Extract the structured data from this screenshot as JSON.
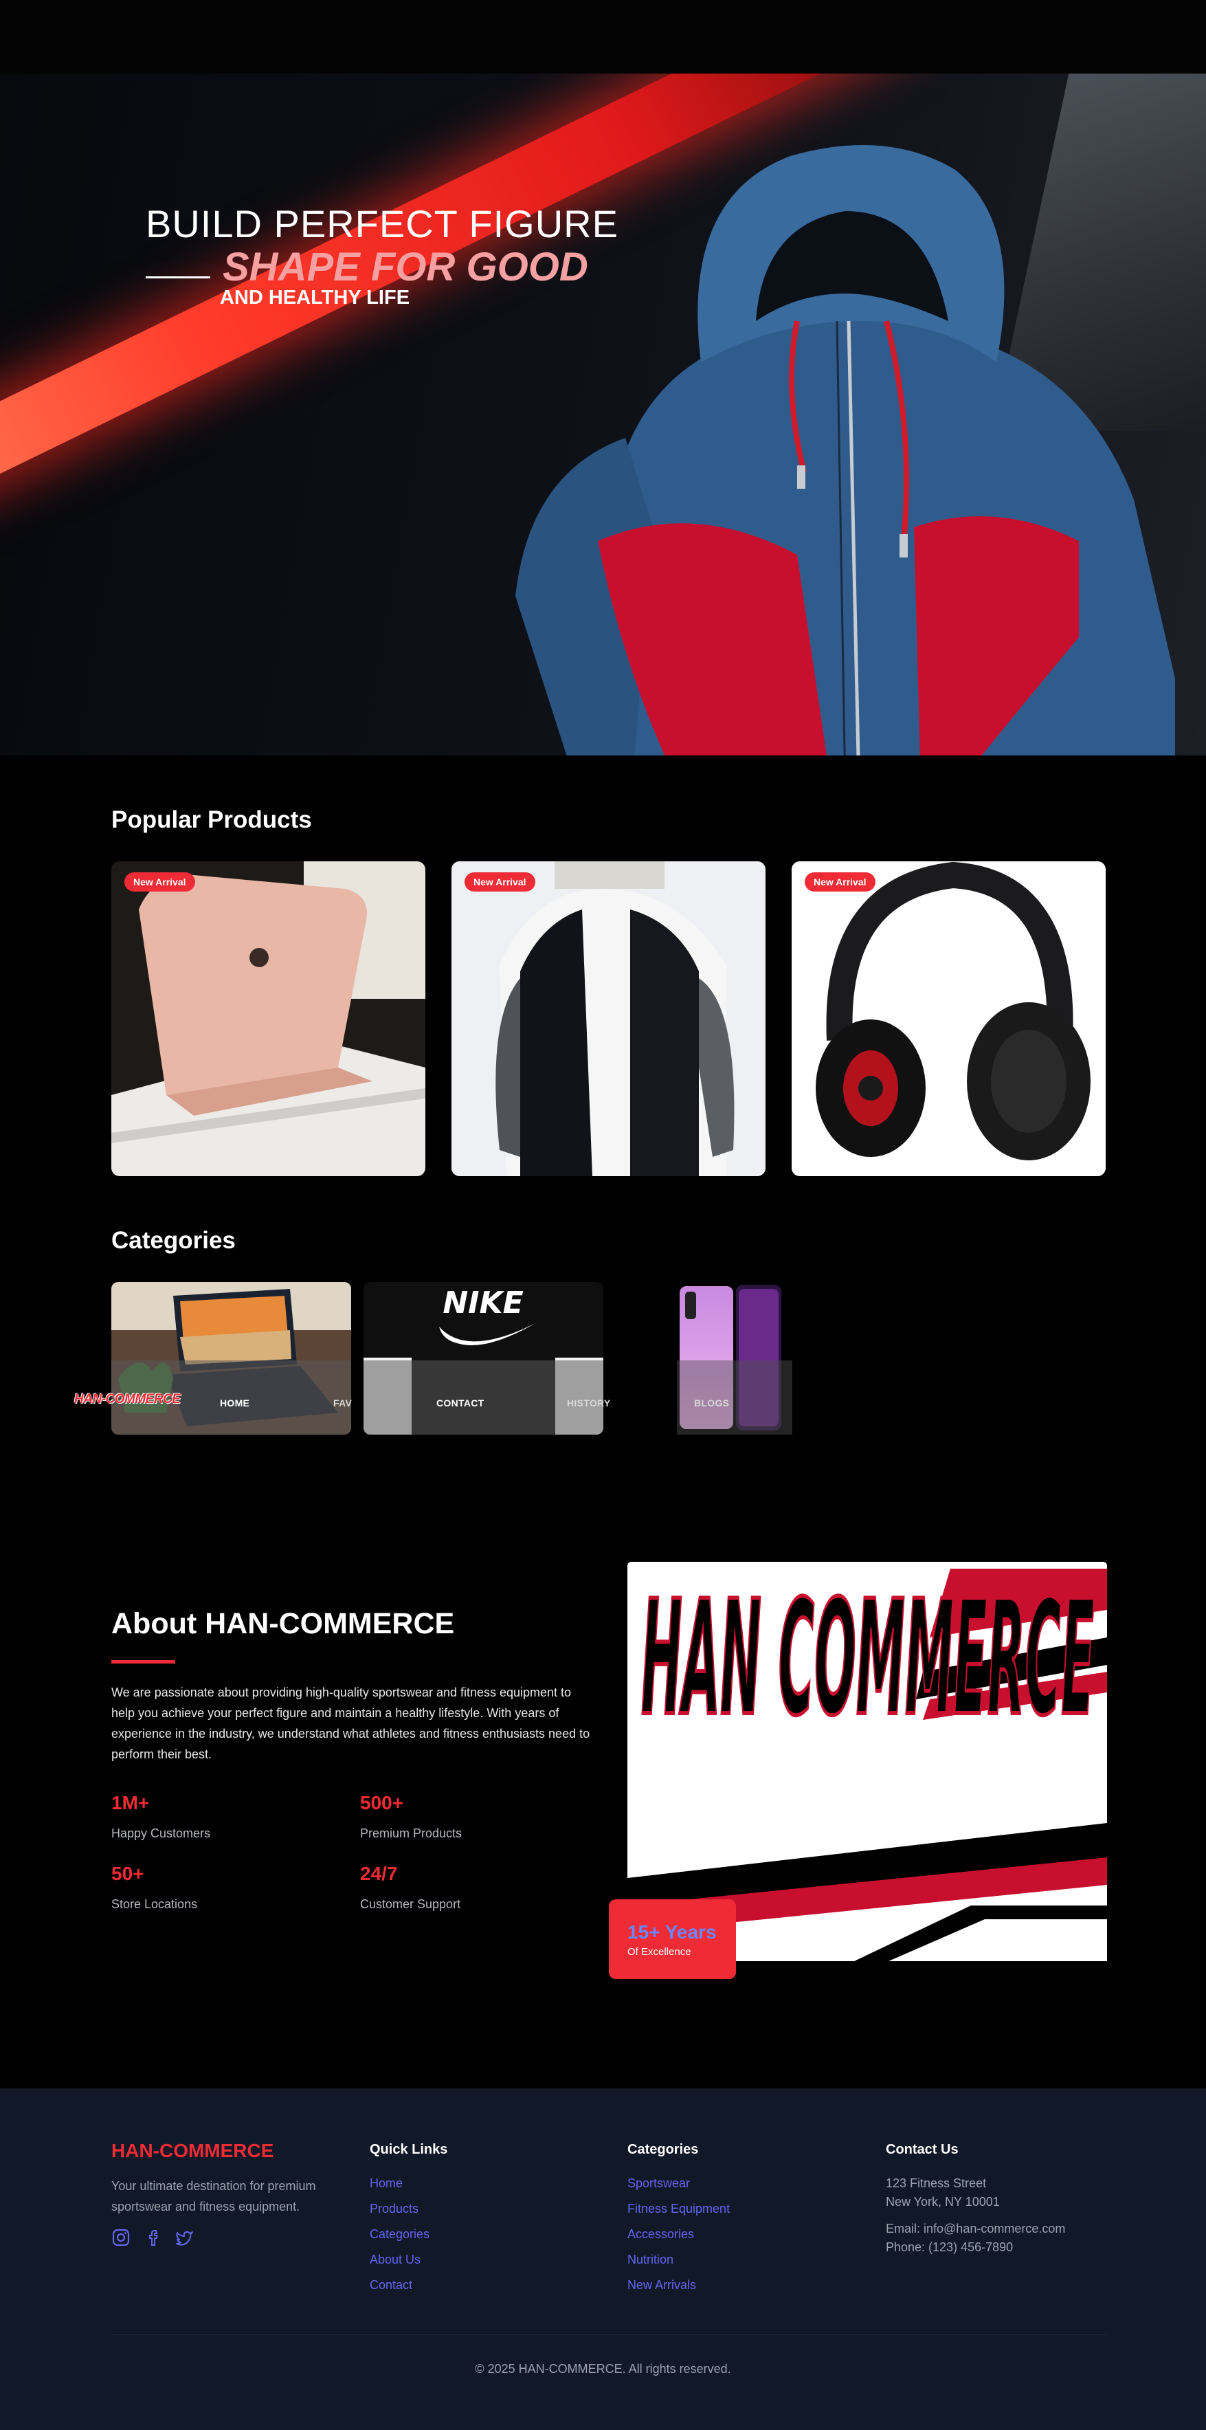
{
  "hero": {
    "line1": "BUILD PERFECT FIGURE",
    "line2": "SHAPE FOR GOOD",
    "line3": "AND HEALTHY LIFE"
  },
  "popular": {
    "title": "Popular Products",
    "items": [
      {
        "badge": "New Arrival",
        "image": "laptop"
      },
      {
        "badge": "New Arrival",
        "image": "jacket"
      },
      {
        "badge": "New Arrival",
        "image": "headphones"
      }
    ]
  },
  "categories": {
    "title": "Categories",
    "logo_text": "HAN-COMMERCE",
    "nav": [
      "HOME",
      "FAV",
      "CONTACT",
      "HISTORY",
      "BLOGS"
    ]
  },
  "about": {
    "title": "About HAN-COMMERCE",
    "body": "We are passionate about providing high-quality sportswear and fitness equipment to help you achieve your perfect figure and maintain a healthy lifestyle. With years of experience in the industry, we understand what athletes and fitness enthusiasts need to perform their best.",
    "stats": [
      {
        "value": "1M+",
        "label": "Happy Customers"
      },
      {
        "value": "500+",
        "label": "Premium Products"
      },
      {
        "value": "50+",
        "label": "Store Locations"
      },
      {
        "value": "24/7",
        "label": "Customer Support"
      }
    ],
    "years_value": "15+ Years",
    "years_label": "Of Excellence",
    "logo_text": "HAN COMMERCE"
  },
  "footer": {
    "brand": "HAN-COMMERCE",
    "description": "Your ultimate destination for premium sportswear and fitness equipment.",
    "social_icons": [
      "instagram-icon",
      "facebook-icon",
      "twitter-icon"
    ],
    "quick_links": {
      "title": "Quick Links",
      "items": [
        "Home",
        "Products",
        "Categories",
        "About Us",
        "Contact"
      ]
    },
    "categories": {
      "title": "Categories",
      "items": [
        "Sportswear",
        "Fitness Equipment",
        "Accessories",
        "Nutrition",
        "New Arrivals"
      ]
    },
    "contact": {
      "title": "Contact Us",
      "address1": "123 Fitness Street",
      "address2": "New York, NY 10001",
      "email": "Email: info@han-commerce.com",
      "phone": "Phone: (123) 456-7890"
    },
    "copyright": "© 2025 HAN-COMMERCE. All rights reserved."
  },
  "colors": {
    "accent": "#ef2b35",
    "link": "#6366f1",
    "footer_bg": "#111827"
  }
}
